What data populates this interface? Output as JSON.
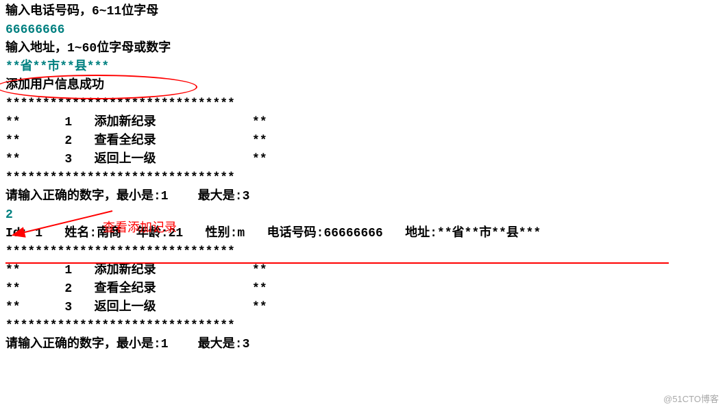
{
  "lines": {
    "l1": "输入电话号码，6~11位字母",
    "l2": "66666666",
    "l3": "输入地址，1~60位字母或数字",
    "l4": "**省**市**县***",
    "l5": "添加用户信息成功",
    "border": "*******************************",
    "menu1": "**      1   添加新纪录             **",
    "menu2": "**      2   查看全纪录             **",
    "menu3": "**      3   返回上一级             **",
    "prompt": "请输入正确的数字，最小是:1    最大是:3",
    "input2": "2",
    "record": "Id: 1   姓名:南商  年龄:21   性别:m   电话号码:66666666   地址:**省**市**县***"
  },
  "annotation": {
    "text": "查看添加记录"
  },
  "watermark": "@51CTO博客"
}
